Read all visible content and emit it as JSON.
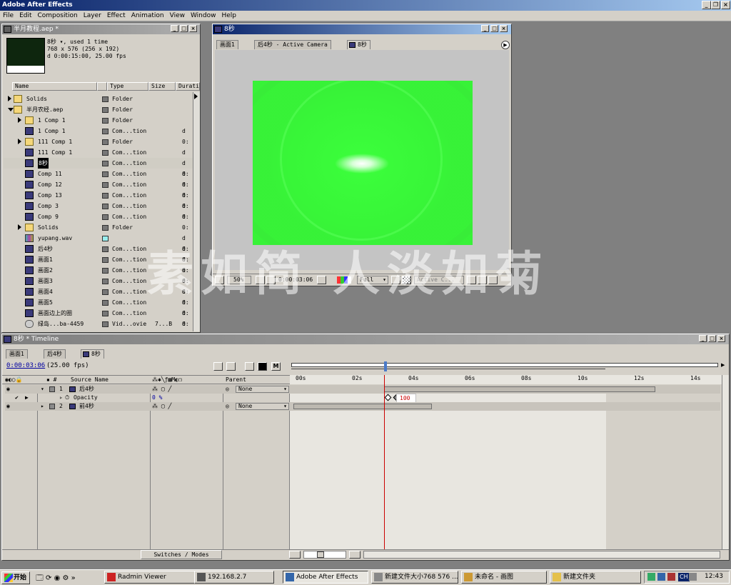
{
  "app": {
    "title": "Adobe After Effects"
  },
  "menu": [
    "File",
    "Edit",
    "Composition",
    "Layer",
    "Effect",
    "Animation",
    "View",
    "Window",
    "Help"
  ],
  "project": {
    "title": "半月教程.aep *",
    "info_name": "8秒 ▾, used 1 time",
    "info_size": "768 x 576  (256 x 192)",
    "info_dur": "d 0:00:15:00, 25.00 fps",
    "columns": {
      "name": "Name",
      "type": "Type",
      "size": "Size",
      "duration": "Durati"
    },
    "items": [
      {
        "name": "Solids",
        "type": "Folder",
        "size": "",
        "dur": ""
      },
      {
        "name": "半月农经.aep",
        "type": "Folder",
        "size": "",
        "dur": ""
      },
      {
        "name": "1 Comp 1",
        "type": "Folder",
        "size": "",
        "dur": ""
      },
      {
        "name": "1 Comp 1",
        "type": "Com...tion",
        "size": "",
        "dur": "d 0:"
      },
      {
        "name": "111 Comp 1",
        "type": "Folder",
        "size": "",
        "dur": ""
      },
      {
        "name": "111 Comp 1",
        "type": "Com...tion",
        "size": "",
        "dur": "d 0:"
      },
      {
        "name": "8秒",
        "type": "Com...tion",
        "size": "",
        "dur": "d 0:"
      },
      {
        "name": "Comp 11",
        "type": "Com...tion",
        "size": "",
        "dur": "d 0:"
      },
      {
        "name": "Comp 12",
        "type": "Com...tion",
        "size": "",
        "dur": "d 0:"
      },
      {
        "name": "Comp 13",
        "type": "Com...tion",
        "size": "",
        "dur": "d 0:"
      },
      {
        "name": "Comp 3",
        "type": "Com...tion",
        "size": "",
        "dur": "d 0:"
      },
      {
        "name": "Comp 9",
        "type": "Com...tion",
        "size": "",
        "dur": "d 0:"
      },
      {
        "name": "Solids",
        "type": "Folder",
        "size": "",
        "dur": ""
      },
      {
        "name": "yupang.wav",
        "type": "",
        "size": "",
        "dur": "d 0:"
      },
      {
        "name": "后4秒",
        "type": "Com...tion",
        "size": "",
        "dur": "d 0:"
      },
      {
        "name": "画面1",
        "type": "Com...tion",
        "size": "",
        "dur": "d 0:"
      },
      {
        "name": "画面2",
        "type": "Com...tion",
        "size": "",
        "dur": "d 0:"
      },
      {
        "name": "画面3",
        "type": "Com...tion",
        "size": "",
        "dur": "d 0:"
      },
      {
        "name": "画面4",
        "type": "Com...tion",
        "size": "",
        "dur": "d 0:"
      },
      {
        "name": "画面5",
        "type": "Com...tion",
        "size": "",
        "dur": "d 0:"
      },
      {
        "name": "画面边上的圈",
        "type": "Com...tion",
        "size": "",
        "dur": "d 0:"
      },
      {
        "name": "绿岛...ba-4459",
        "type": "Vid...ovie",
        "size": "7...B",
        "dur": "d 0:"
      }
    ]
  },
  "comp": {
    "title": "8秒",
    "tabs": [
      "画面1",
      "后4秒 - Active Camera",
      "8秒"
    ],
    "zoom": "50%",
    "timecode": "0:00:03:06",
    "resolution": "Full",
    "camera": "Active C..."
  },
  "timeline": {
    "title": "8秒 * Timeline",
    "tabs": [
      "画面1",
      "后4秒",
      "8秒"
    ],
    "timecode": "0:00:03:06",
    "fps": "(25.00 fps)",
    "col_source": "Source Name",
    "col_parent": "Parent",
    "ruler": [
      "00s",
      "02s",
      "04s",
      "06s",
      "08s",
      "10s",
      "12s",
      "14s"
    ],
    "layers": [
      {
        "num": "1",
        "name": "后4秒",
        "parent": "None"
      },
      {
        "num": "",
        "name": "Opacity",
        "value": "0 %",
        "key": "100"
      },
      {
        "num": "2",
        "name": "前4秒",
        "parent": "None"
      }
    ],
    "switches_label": "Switches / Modes"
  },
  "watermark": "素如简 人淡如菊",
  "taskbar": {
    "start": "开始",
    "tasks": [
      "Radmin Viewer",
      "192.168.2.7",
      "Adobe After Effects",
      "新建文件大小768 576 ...",
      "未命名 - 画图",
      "新建文件夹"
    ],
    "lang": "CH",
    "clock": "12:43"
  }
}
